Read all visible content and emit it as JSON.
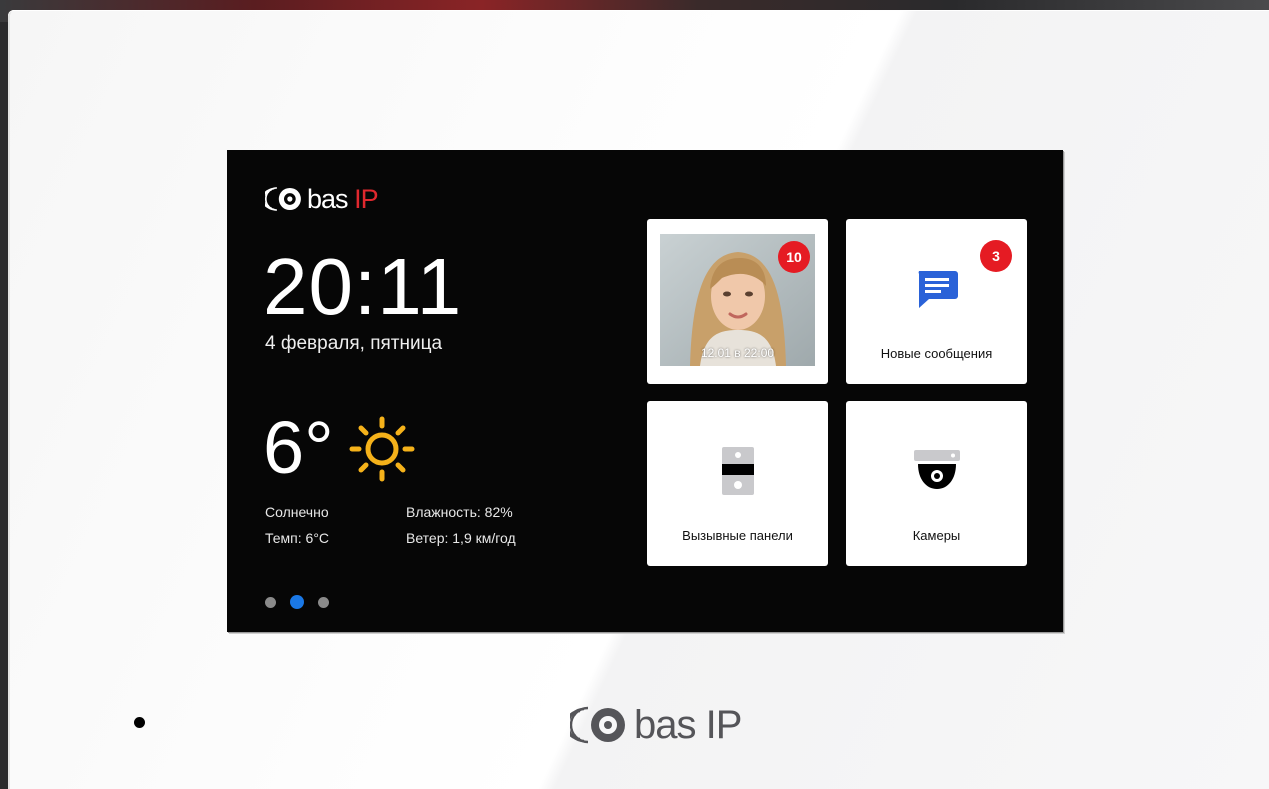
{
  "brand": {
    "name_main": "bas",
    "name_accent": "IP",
    "accent_color": "#e0282e"
  },
  "clock": {
    "time": "20:11",
    "date": "4 февраля, пятница"
  },
  "weather": {
    "temperature": "6°",
    "icon": "sun-icon",
    "condition": "Солнечно",
    "temp_line": "Темп: 6°C",
    "humidity": "Влажность: 82%",
    "wind": "Ветер: 1,9 км/год"
  },
  "pager": {
    "pages": 3,
    "active_index": 1,
    "active_color": "#1a78e6"
  },
  "tiles": {
    "visitor": {
      "badge": "10",
      "timestamp": "12.01 в 22:00"
    },
    "messages": {
      "badge": "3",
      "label": "Новые сообщения",
      "icon": "message-icon",
      "icon_color": "#2a62d8"
    },
    "panels": {
      "label": "Вызывные панели",
      "icon": "door-panel-icon"
    },
    "cameras": {
      "label": "Камеры",
      "icon": "dome-camera-icon"
    }
  },
  "badge_color": "#e51b23"
}
